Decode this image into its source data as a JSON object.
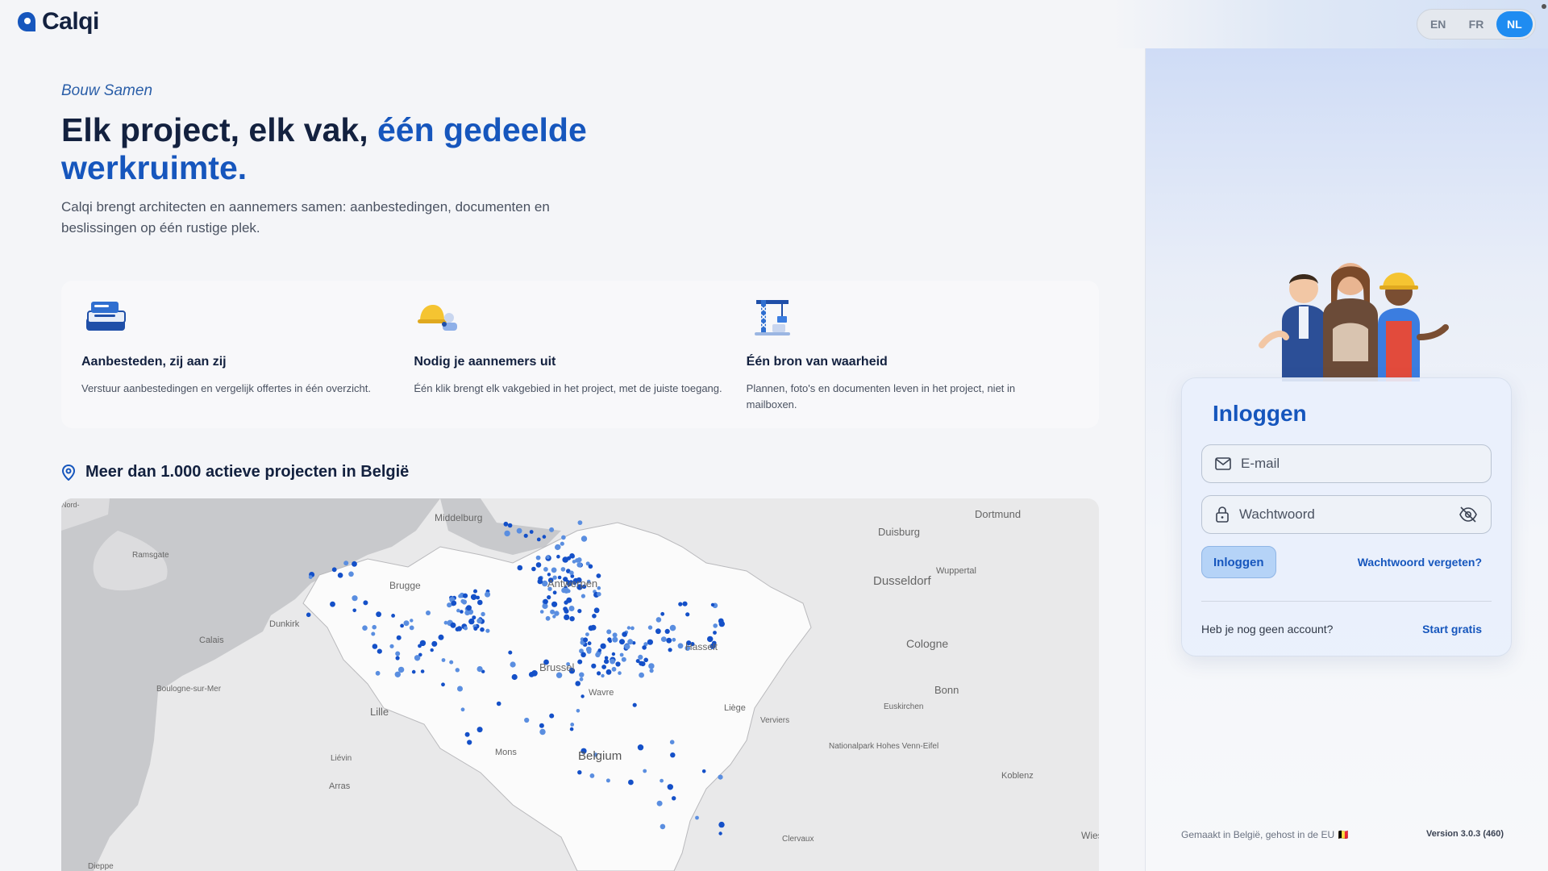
{
  "app": {
    "name": "Calqi"
  },
  "colors": {
    "brand": "#1656bd",
    "accent": "#1f8cf1",
    "heading": "#13213f"
  },
  "language": {
    "options": [
      "EN",
      "FR",
      "NL"
    ],
    "selected": "NL"
  },
  "hero": {
    "eyebrow": "Bouw Samen",
    "headline_part1": "Elk project, elk vak,",
    "headline_accent": "één gedeelde werkruimte.",
    "subtitle": "Calqi brengt architecten en aannemers samen: aanbestedingen, documenten en beslissingen op één rustige plek."
  },
  "features": [
    {
      "icon": "tender-stack-icon",
      "title": "Aanbesteden, zij aan zij",
      "description": "Verstuur aanbestedingen en vergelijk offertes in één overzicht."
    },
    {
      "icon": "hardhat-invite-icon",
      "title": "Nodig je aannemers uit",
      "description": "Één klik brengt elk vakgebied in het project, met de juiste toegang."
    },
    {
      "icon": "crane-source-icon",
      "title": "Één bron van waarheid",
      "description": "Plannen, foto's en documenten leven in het project, niet in mailboxen."
    }
  ],
  "projects": {
    "title": "Meer dan 1.000 actieve projecten in België",
    "map_labels": [
      "Middelburg",
      "Dortmund",
      "Duisburg",
      "Ramsgate",
      "Wuppertal",
      "Brugge",
      "Antwerpen",
      "Dusseldorf",
      "Dunkirk",
      "Calais",
      "Hasselt",
      "Cologne",
      "Brussel",
      "Boulogne-sur-Mer",
      "Lille",
      "Wavre",
      "Bonn",
      "Liège",
      "Euskirchen",
      "Verviers",
      "Mons",
      "Belgium",
      "Nationalpark Hohes Venn-Eifel",
      "Liévin",
      "Koblenz",
      "Arras",
      "Clervaux",
      "Dieppe",
      "Wiesbaden",
      "Nord-"
    ]
  },
  "login": {
    "title": "Inloggen",
    "email_placeholder": "E-mail",
    "password_placeholder": "Wachtwoord",
    "submit_label": "Inloggen",
    "forgot_label": "Wachtwoord vergeten?",
    "no_account_text": "Heb je nog geen account?",
    "signup_label": "Start gratis"
  },
  "footer": {
    "made_in": "Gemaakt in België, gehost in de EU 🇧🇪",
    "version": "Version 3.0.3 (460)"
  }
}
